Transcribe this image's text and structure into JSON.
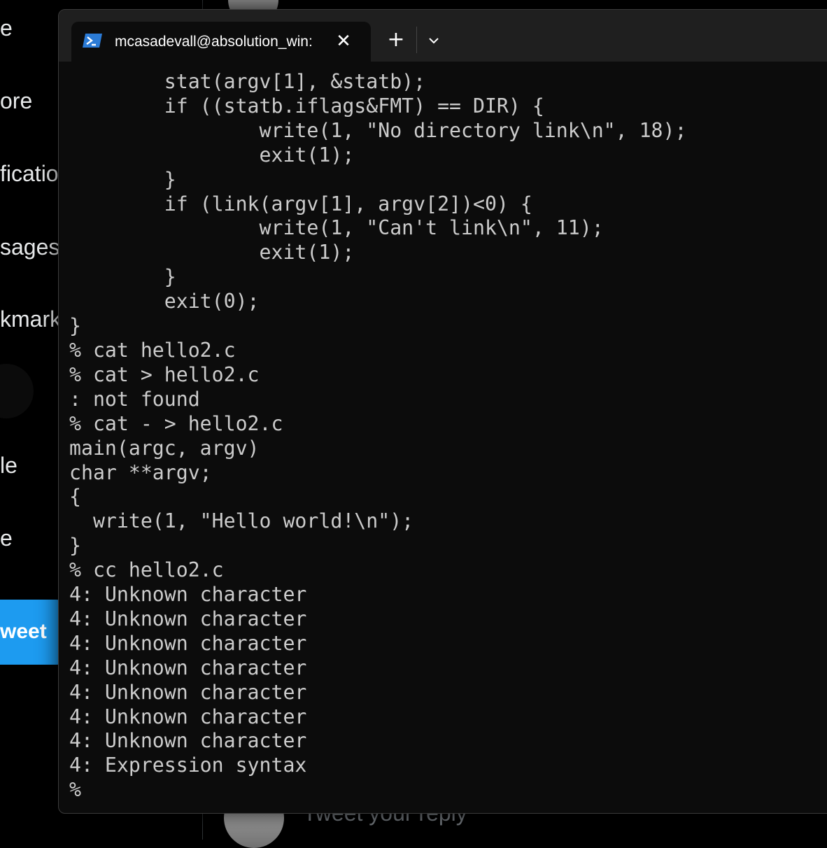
{
  "background_app": {
    "nav_items": [
      {
        "label": "e",
        "icon": "home-icon"
      },
      {
        "label": "ore",
        "icon": "explore-icon"
      },
      {
        "label": "ficatio",
        "icon": "notifications-icon"
      },
      {
        "label": "sages",
        "icon": "messages-icon"
      },
      {
        "label": "kmark",
        "icon": "bookmarks-icon"
      },
      {
        "label": "le",
        "icon": "profile-icon"
      },
      {
        "label": "e",
        "icon": "more-icon"
      }
    ],
    "tweet_button_label": "weet",
    "reply_placeholder": "Tweet your reply",
    "accent_color": "#1d9bf0"
  },
  "terminal": {
    "tab_title": "mcasadevall@absolution_win:",
    "tab_icon": "powershell-icon",
    "close_icon": "close-icon",
    "new_tab_icon": "plus-icon",
    "dropdown_icon": "chevron-down-icon",
    "lines": [
      "        stat(argv[1], &statb);",
      "        if ((statb.iflags&FMT) == DIR) {",
      "                write(1, \"No directory link\\n\", 18);",
      "                exit(1);",
      "        }",
      "        if (link(argv[1], argv[2])<0) {",
      "                write(1, \"Can't link\\n\", 11);",
      "                exit(1);",
      "        }",
      "        exit(0);",
      "}",
      "% cat hello2.c",
      "% cat > hello2.c",
      ": not found",
      "% cat - > hello2.c",
      "main(argc, argv)",
      "char **argv;",
      "{",
      "  write(1, \"Hello world!\\n\");",
      "}",
      "% cc hello2.c",
      "4: Unknown character",
      "4: Unknown character",
      "4: Unknown character",
      "4: Unknown character",
      "4: Unknown character",
      "4: Unknown character",
      "4: Unknown character",
      "4: Expression syntax",
      "%"
    ]
  }
}
